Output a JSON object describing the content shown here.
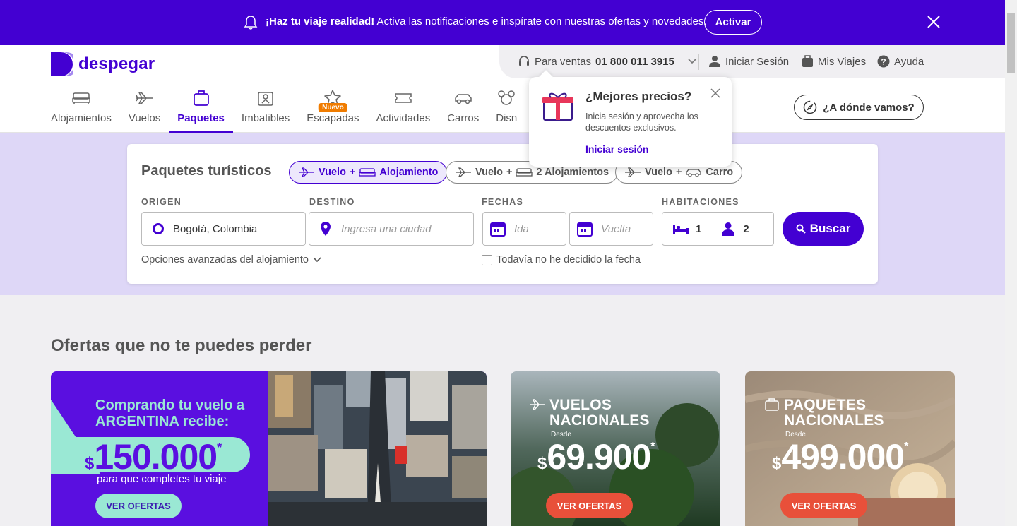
{
  "notification": {
    "bold": "¡Haz tu viaje realidad!",
    "text": " Activa las notificaciones e inspírate con nuestras ofertas y novedades.",
    "button": "Activar"
  },
  "brand": {
    "name": "despegar",
    "color": "#4300d2"
  },
  "topbar": {
    "sales_label": "Para ventas",
    "sales_phone": "01 800 011 3915",
    "login": "Iniciar Sesión",
    "trips": "Mis Viajes",
    "help": "Ayuda"
  },
  "nav": {
    "tabs": [
      {
        "label": "Alojamientos",
        "icon": "bed-icon"
      },
      {
        "label": "Vuelos",
        "icon": "plane-icon"
      },
      {
        "label": "Paquetes",
        "icon": "suitcase-icon"
      },
      {
        "label": "Imbatibles",
        "icon": "offers-icon"
      },
      {
        "label": "Escapadas",
        "icon": "star-icon",
        "badge": "Nuevo"
      },
      {
        "label": "Actividades",
        "icon": "ticket-icon"
      },
      {
        "label": "Carros",
        "icon": "car-icon"
      },
      {
        "label": "Disn",
        "icon": "disney-icon"
      }
    ],
    "where_button": "¿A dónde vamos?"
  },
  "popover": {
    "title": "¿Mejores precios?",
    "desc": "Inicia sesión y aprovecha los descuentos exclusivos.",
    "link": "Iniciar sesión"
  },
  "search": {
    "title": "Paquetes turísticos",
    "chips": [
      {
        "a": "Vuelo",
        "plus": "+",
        "b": "Alojamiento"
      },
      {
        "a": "Vuelo",
        "plus": "+",
        "b": "2 Alojamientos"
      },
      {
        "a": "Vuelo",
        "plus": "+",
        "b": "Carro"
      }
    ],
    "labels": {
      "origin": "ORIGEN",
      "destination": "DESTINO",
      "dates": "FECHAS",
      "rooms": "HABITACIONES"
    },
    "origin_value": "Bogotá, Colombia",
    "destination_placeholder": "Ingresa una ciudad",
    "date_from_placeholder": "Ida",
    "date_to_placeholder": "Vuelta",
    "rooms": "1",
    "people": "2",
    "search_button": "Buscar",
    "advanced": "Opciones avanzadas del alojamiento",
    "no_date": "Todavía no he decidido la fecha"
  },
  "offers": {
    "title": "Ofertas que no te puedes perder",
    "main": {
      "title": "Comprando tu vuelo a ARGENTINA recibe:",
      "currency": "$",
      "amount": "150.000",
      "asterisk": "*",
      "subtitle": "para que completes tu viaje",
      "button": "VER OFERTAS"
    },
    "cards": [
      {
        "title_line1": "VUELOS",
        "title_line2": "NACIONALES",
        "desde": "Desde",
        "currency": "$",
        "amount": "69.900",
        "asterisk": "*",
        "button": "VER OFERTAS"
      },
      {
        "title_line1": "PAQUETES",
        "title_line2": "NACIONALES",
        "desde": "Desde",
        "currency": "$",
        "amount": "499.000",
        "asterisk": "*",
        "button": "VER OFERTAS"
      }
    ]
  }
}
